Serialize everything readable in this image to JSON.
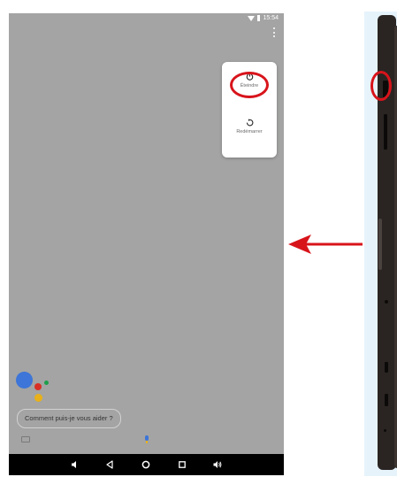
{
  "status_bar": {
    "time": "15:54"
  },
  "power_menu": {
    "power_off_label": "Éteindre",
    "restart_label": "Redémarrer"
  },
  "assistant": {
    "prompt": "Comment puis-je vous aider ?"
  },
  "colors": {
    "screen_bg": "#a3a4a3",
    "highlight": "#d8141b",
    "google_blue": "#3d75d8",
    "google_red": "#d93025",
    "google_yellow": "#e8b119",
    "google_green": "#1e9e4a",
    "device_body": "#2a2523",
    "side_bg": "#e6f3fb"
  },
  "icons": {
    "status": [
      "wifi-icon",
      "battery-icon"
    ],
    "power_menu": [
      "power-icon",
      "restart-icon"
    ],
    "assistant": [
      "keyboard-icon",
      "mic-icon"
    ],
    "navigation": [
      "volume-down-icon",
      "back-icon",
      "home-icon",
      "recents-icon",
      "volume-up-icon"
    ]
  }
}
